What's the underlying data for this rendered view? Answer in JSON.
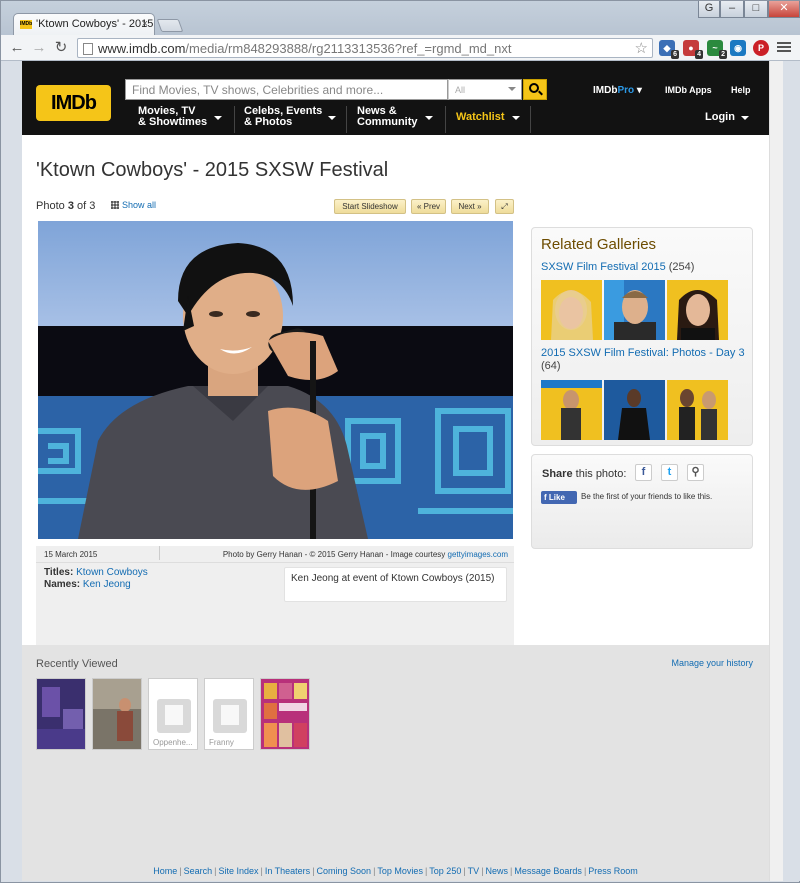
{
  "browser": {
    "tab_title": "'Ktown Cowboys' - 2015 S",
    "tab_favicon": "IMDb",
    "url_host": "www.imdb.com",
    "url_path": "/media/rm848293888/rg2113313536?ref_=rgmd_md_nxt",
    "window_user": "G"
  },
  "extensions": [
    {
      "icon": "shield-extension-icon",
      "badge": "6",
      "color": "#3b6fb6"
    },
    {
      "icon": "blocker-extension-icon",
      "badge": "4",
      "color": "#c53b3b"
    },
    {
      "icon": "activity-extension-icon",
      "badge": "2",
      "color": "#2b8a3e"
    },
    {
      "icon": "camera-extension-icon",
      "badge": "",
      "color": "#1b79c2"
    },
    {
      "icon": "pinterest-icon",
      "badge": "",
      "color": "#cb2027"
    }
  ],
  "header": {
    "logo": "IMDb",
    "search_placeholder": "Find Movies, TV shows, Celebrities and more...",
    "search_category": "All",
    "pro": "IMDb",
    "pro_suffix": "Pro",
    "apps": "IMDb Apps",
    "help": "Help",
    "nav": [
      {
        "line1": "Movies, TV",
        "line2": "& Showtimes"
      },
      {
        "line1": "Celebs, Events",
        "line2": "& Photos"
      },
      {
        "line1": "News &",
        "line2": "Community"
      }
    ],
    "watchlist": "Watchlist",
    "login": "Login"
  },
  "gallery": {
    "title": "'Ktown Cowboys' - 2015 SXSW Festival",
    "photo_label": "Photo",
    "photo_index": "3",
    "photo_of": "of",
    "photo_total": "3",
    "show_all": "Show all",
    "slideshow": "Start Slideshow",
    "prev": "« Prev",
    "next": "Next »"
  },
  "photo_meta": {
    "date": "15 March 2015",
    "credit": "Photo by Gerry Hanan - © 2015 Gerry Hanan - Image courtesy",
    "credit_link": "gettyimages.com",
    "titles_label": "Titles:",
    "titles_value": "Ktown Cowboys",
    "names_label": "Names:",
    "names_value": "Ken Jeong",
    "caption": "Ken Jeong at event of Ktown Cowboys (2015)"
  },
  "related": {
    "heading": "Related Galleries",
    "galleries": [
      {
        "name": "SXSW Film Festival 2015",
        "count": "(254)"
      },
      {
        "name": "2015 SXSW Film Festival: Photos - Day 3",
        "count": "(64)"
      }
    ]
  },
  "share": {
    "label_bold": "Share",
    "label_rest": "this photo:",
    "like": "Like",
    "like_text": "Be the first of your friends to like this."
  },
  "recently_viewed": {
    "title": "Recently Viewed",
    "manage": "Manage your history",
    "items": [
      {
        "name": ""
      },
      {
        "name": ""
      },
      {
        "name": "Oppenhe..."
      },
      {
        "name": "Franny"
      },
      {
        "name": ""
      }
    ]
  },
  "footer": {
    "links": [
      "Home",
      "Search",
      "Site Index",
      "In Theaters",
      "Coming Soon",
      "Top Movies",
      "Top 250",
      "TV",
      "News",
      "Message Boards",
      "Press Room"
    ]
  }
}
